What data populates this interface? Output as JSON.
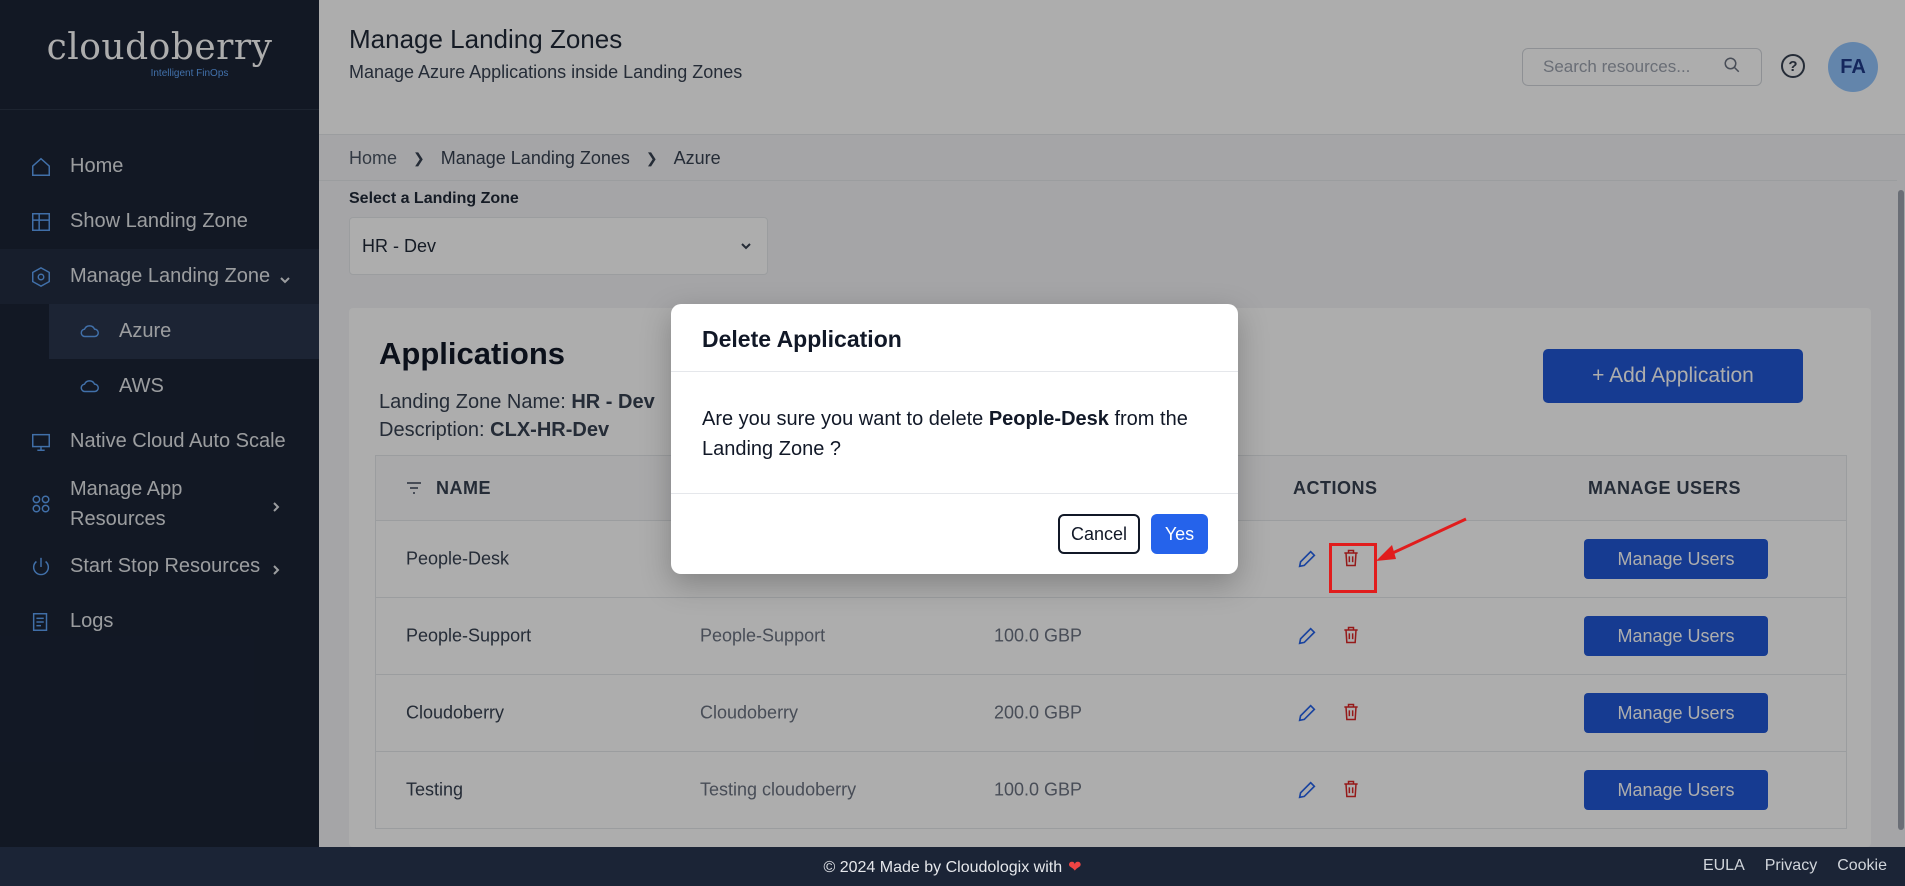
{
  "brand": {
    "name": "cloudoberry",
    "tagline": "Intelligent FinOps"
  },
  "sidebar": {
    "items": [
      {
        "label": "Home",
        "icon": "home-icon"
      },
      {
        "label": "Show Landing Zone",
        "icon": "grid-icon"
      },
      {
        "label": "Manage Landing Zone",
        "icon": "settings-hex-icon",
        "expanded": true,
        "children": [
          {
            "label": "Azure",
            "icon": "cloud-icon",
            "selected": true
          },
          {
            "label": "AWS",
            "icon": "cloud-icon"
          }
        ]
      },
      {
        "label": "Native Cloud Auto Scale",
        "icon": "monitor-icon"
      },
      {
        "label": "Manage App Resources",
        "icon": "apps-icon"
      },
      {
        "label": "Start Stop Resources",
        "icon": "power-icon"
      },
      {
        "label": "Logs",
        "icon": "logs-icon"
      }
    ]
  },
  "header": {
    "title": "Manage Landing Zones",
    "subtitle": "Manage Azure Applications inside Landing Zones",
    "search_placeholder": "Search resources...",
    "help": "?",
    "avatar_initials": "FA"
  },
  "breadcrumb": [
    "Home",
    "Manage Landing Zones",
    "Azure"
  ],
  "landing_zone_select": {
    "label": "Select a Landing Zone",
    "value": "HR - Dev"
  },
  "applications": {
    "title": "Applications",
    "zone_name_label": "Landing Zone Name:",
    "zone_name": "HR - Dev",
    "description_label": "Description:",
    "description": "CLX-HR-Dev",
    "add_button": "+ Add Application",
    "columns": {
      "name": "NAME",
      "actions": "ACTIONS",
      "manage_users": "MANAGE USERS"
    },
    "rows": [
      {
        "name": "People-Desk",
        "description": "",
        "budget": ""
      },
      {
        "name": "People-Support",
        "description": "People-Support",
        "budget": "100.0 GBP"
      },
      {
        "name": "Cloudoberry",
        "description": "Cloudoberry",
        "budget": "200.0 GBP"
      },
      {
        "name": "Testing",
        "description": "Testing cloudoberry",
        "budget": "100.0 GBP"
      }
    ],
    "manage_users_button": "Manage Users"
  },
  "modal": {
    "title": "Delete Application",
    "body_prefix": "Are you sure you want to delete",
    "body_target": "People-Desk",
    "body_suffix": "from the Landing Zone ?",
    "cancel": "Cancel",
    "confirm": "Yes"
  },
  "footer": {
    "copyright": "© 2024 Made by Cloudologix with",
    "links": [
      "EULA",
      "Privacy",
      "Cookie"
    ]
  },
  "colors": {
    "sidebar_bg": "#1b2436",
    "accent": "#2158d6",
    "danger": "#dc2626",
    "annotation": "#e11d1d"
  }
}
